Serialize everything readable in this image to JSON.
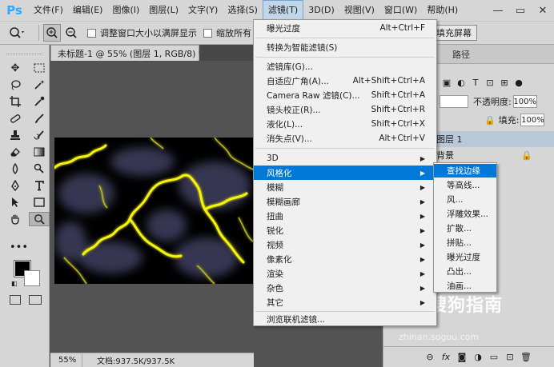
{
  "app": {
    "logo": "Ps"
  },
  "menubar": {
    "items": [
      "文件(F)",
      "编辑(E)",
      "图像(I)",
      "图层(L)",
      "文字(Y)",
      "选择(S)",
      "滤镜(T)",
      "3D(D)",
      "视图(V)",
      "窗口(W)",
      "帮助(H)"
    ],
    "active_index": 6
  },
  "window_controls": {
    "minimize": "—",
    "maximize": "▭",
    "close": "✕"
  },
  "options": {
    "resize_label": "调整窗口大小以满屏显示",
    "zoom_all_label": "缩放所有",
    "fill_screen": "填充屏幕"
  },
  "document": {
    "tab_title": "未标题-1 @ 55% (图层 1, RGB/8) *",
    "close": "×",
    "zoom": "55%",
    "doc_info": "文档:937.5K/937.5K"
  },
  "right_panel": {
    "paths_tab": "路径",
    "opacity_label": "不透明度:",
    "opacity_value": "100%",
    "fill_label": "填充:",
    "fill_value": "100%",
    "layers": [
      "图层 1",
      "背景"
    ],
    "lock_icon": "lock-icon",
    "bottom_icons": [
      "link-icon",
      "fx-icon",
      "mask-icon",
      "adjust-icon",
      "folder-icon",
      "new-layer-icon",
      "trash-icon"
    ]
  },
  "filter_menu": {
    "items": [
      {
        "label": "曝光过度",
        "shortcut": "Alt+Ctrl+F"
      },
      {
        "label": "转换为智能滤镜(S)",
        "shortcut": ""
      },
      {
        "label": "滤镜库(G)...",
        "shortcut": ""
      },
      {
        "label": "自适应广角(A)...",
        "shortcut": "Alt+Shift+Ctrl+A"
      },
      {
        "label": "Camera Raw 滤镜(C)...",
        "shortcut": "Shift+Ctrl+A"
      },
      {
        "label": "镜头校正(R)...",
        "shortcut": "Shift+Ctrl+R"
      },
      {
        "label": "液化(L)...",
        "shortcut": "Shift+Ctrl+X"
      },
      {
        "label": "消失点(V)...",
        "shortcut": "Alt+Ctrl+V"
      },
      {
        "label": "3D",
        "shortcut": ""
      },
      {
        "label": "风格化",
        "shortcut": ""
      },
      {
        "label": "模糊",
        "shortcut": ""
      },
      {
        "label": "模糊画廊",
        "shortcut": ""
      },
      {
        "label": "扭曲",
        "shortcut": ""
      },
      {
        "label": "锐化",
        "shortcut": ""
      },
      {
        "label": "视频",
        "shortcut": ""
      },
      {
        "label": "像素化",
        "shortcut": ""
      },
      {
        "label": "渲染",
        "shortcut": ""
      },
      {
        "label": "杂色",
        "shortcut": ""
      },
      {
        "label": "其它",
        "shortcut": ""
      },
      {
        "label": "浏览联机滤镜...",
        "shortcut": ""
      }
    ],
    "submenu_arrow": "▶"
  },
  "stylize_submenu": {
    "items": [
      "查找边缘",
      "等高线...",
      "风...",
      "浮雕效果...",
      "扩散...",
      "拼贴...",
      "曝光过度",
      "凸出...",
      "油画..."
    ],
    "highlight_index": 0
  },
  "watermark": {
    "text": "搜狗指南",
    "url": "zhinan.sogou.com"
  },
  "colors": {
    "accent": "#0078d7",
    "lightning": "#f5f20a",
    "panel": "#d6d6d6",
    "workspace": "#535353"
  }
}
